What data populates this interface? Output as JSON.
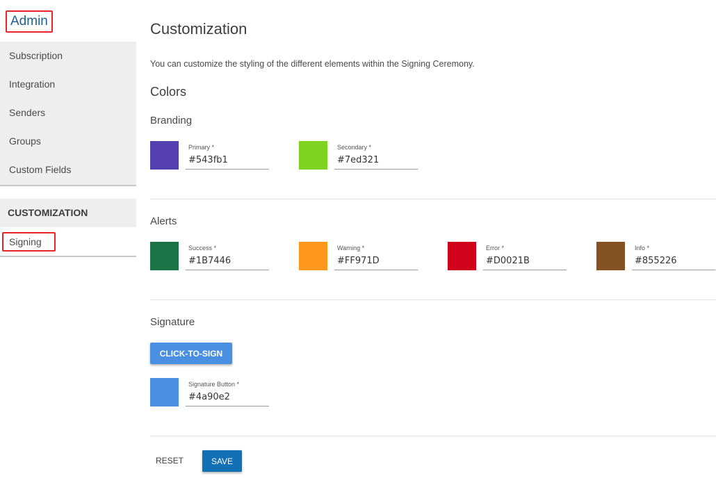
{
  "sidebar": {
    "title": "Admin",
    "admin_items": [
      {
        "label": "Subscription"
      },
      {
        "label": "Integration"
      },
      {
        "label": "Senders"
      },
      {
        "label": "Groups"
      },
      {
        "label": "Custom Fields"
      }
    ],
    "customization_header": "CUSTOMIZATION",
    "customization_items": [
      {
        "label": "Signing",
        "active": true
      }
    ]
  },
  "main": {
    "title": "Customization",
    "intro": "You can customize the styling of the different elements within the Signing Ceremony.",
    "colors_title": "Colors",
    "branding": {
      "title": "Branding",
      "fields": [
        {
          "label": "Primary *",
          "value": "#543fb1",
          "color": "#543fb1"
        },
        {
          "label": "Secondary *",
          "value": "#7ed321",
          "color": "#7ed321"
        }
      ]
    },
    "alerts": {
      "title": "Alerts",
      "fields": [
        {
          "label": "Success *",
          "value": "#1B7446",
          "color": "#1B7446"
        },
        {
          "label": "Warning *",
          "value": "#FF971D",
          "color": "#FF971D"
        },
        {
          "label": "Error *",
          "value": "#D0021B",
          "color": "#D0021B"
        },
        {
          "label": "Info *",
          "value": "#855226",
          "color": "#855226"
        }
      ]
    },
    "signature": {
      "title": "Signature",
      "preview_button": "CLICK-TO-SIGN",
      "fields": [
        {
          "label": "Signature Button *",
          "value": "#4a90e2",
          "color": "#4a90e2"
        }
      ]
    },
    "actions": {
      "reset": "RESET",
      "save": "SAVE"
    }
  }
}
